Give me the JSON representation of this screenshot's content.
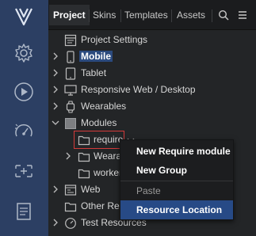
{
  "tabs": {
    "project": "Project",
    "skins": "Skins",
    "templates": "Templates",
    "assets": "Assets"
  },
  "tree": {
    "project_settings": "Project Settings",
    "mobile": "Mobile",
    "tablet": "Tablet",
    "responsive": "Responsive Web / Desktop",
    "wearables": "Wearables",
    "modules": "Modules",
    "require": "require",
    "wearables_child": "Weara",
    "workers": "worker",
    "web": "Web",
    "other_resources": "Other Res",
    "test_resources": "Test Resources"
  },
  "context_menu": {
    "new_require_module": "New Require module",
    "new_group": "New Group",
    "paste": "Paste",
    "resource_location": "Resource Location"
  },
  "colors": {
    "activity_bar": "#2c3f63",
    "panel_bg": "#232527",
    "selection": "#2b4a7e",
    "menu_active": "#274a86",
    "highlight_border": "#d43a3a"
  }
}
